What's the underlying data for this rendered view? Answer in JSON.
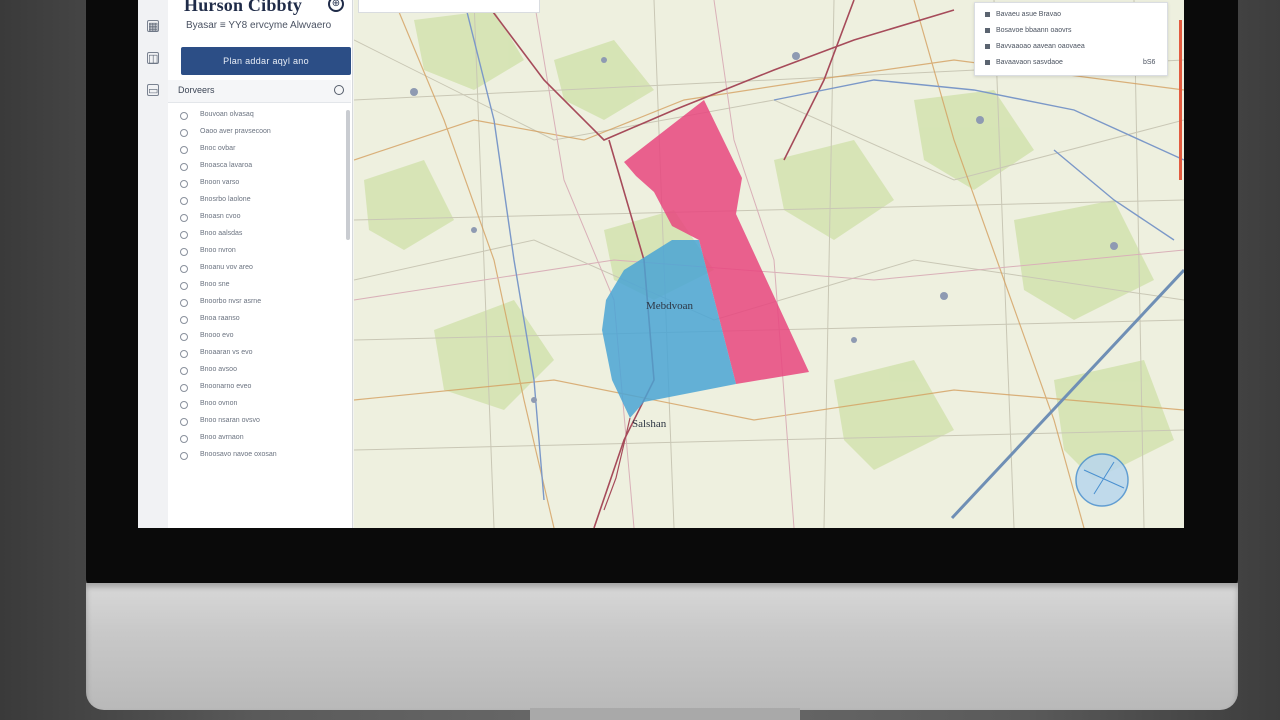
{
  "app": {
    "title": "Hurson Cibbty",
    "subtitle": "Byasar ≡ YY8 ervcyme Alwvaero",
    "action_button": "Plan addar aqyl   ano"
  },
  "list": {
    "header": "Dorveers",
    "items": [
      "Bouvoan olvasaq",
      "Oaoo aver pravsecoon",
      "Bnoc ovbar",
      "Bnoasca lavaroa",
      "Bnoon varso",
      "Bnosrbo laolone",
      "Bnoasn cvoo",
      "Bnoo aalsdas",
      "Bnoo nvron",
      "Bnoanu vov areo",
      "Bnoo sne",
      "Bnoorbo nvsr asrne",
      "Bnoa raanso",
      "Bnooo evo",
      "Bnoaaran vs evo",
      "Bnoo avsoo",
      "Bnoonarno eveo",
      "Bnoo ovnon",
      "Bnoo nsaran ovsvo",
      "Bnoo avrnaon",
      "Bnoosavo navoe oxosan"
    ]
  },
  "legend": {
    "rows": [
      "Bavaeu asue Bravao",
      "Bosavoe bbaann oaovrs",
      "Bavvaaoao aavean oaovaea",
      "Bavaavaon sasvdaoe"
    ],
    "corner": "bS6"
  },
  "map": {
    "label_center": "Mebdvoan",
    "label_bottom": "Salshan",
    "colors": {
      "pink_region": "#e8477f",
      "blue_region": "#4aa5d5"
    }
  },
  "icons": {
    "rail": [
      "grid-icon",
      "layers-icon",
      "settings-icon"
    ],
    "title": "globe-icon"
  }
}
